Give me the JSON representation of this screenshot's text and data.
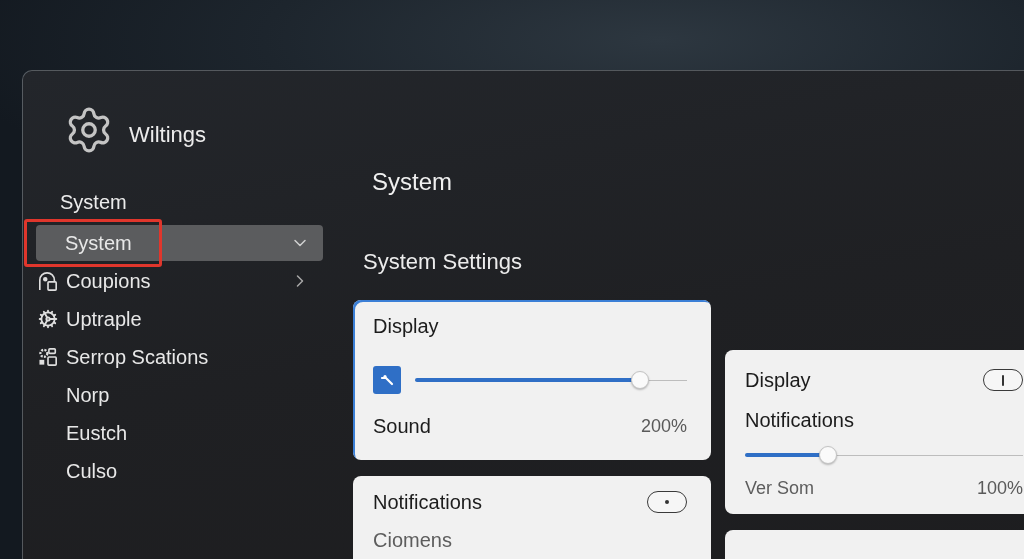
{
  "app": {
    "title": "Wiltings"
  },
  "sidebar": {
    "items": [
      {
        "kind": "header",
        "label": "System"
      },
      {
        "kind": "entry",
        "label": "System",
        "selected": true,
        "expanded": true,
        "outlined": true
      },
      {
        "kind": "item",
        "label": "Coupions",
        "selected": false,
        "expanded": false
      },
      {
        "kind": "item",
        "label": "Uptraple",
        "selected": false
      },
      {
        "kind": "item",
        "label": "Serrop Scations",
        "selected": false
      },
      {
        "kind": "item",
        "label": "Norp",
        "selected": false
      },
      {
        "kind": "item",
        "label": "Eustch",
        "selected": false
      },
      {
        "kind": "item",
        "label": "Culso",
        "selected": false
      }
    ]
  },
  "content": {
    "title": "System",
    "section": "System Settings",
    "cards": [
      {
        "selected": true,
        "rows": [
          {
            "kind": "title",
            "label": "Display"
          },
          {
            "kind": "icon-slider",
            "level": 0.85
          },
          {
            "kind": "value",
            "label": "Sound",
            "value": "200%"
          }
        ]
      },
      {
        "selected": false,
        "rows": [
          {
            "kind": "toggle",
            "label": "Display",
            "on": true
          },
          {
            "kind": "title",
            "label": "Notifications"
          },
          {
            "kind": "slider",
            "level": 0.285
          },
          {
            "kind": "caption-value",
            "label": "Ver Som",
            "value": "100%"
          }
        ]
      },
      {
        "selected": false,
        "rows": [
          {
            "kind": "toggle",
            "label": "Notifications",
            "on": false
          },
          {
            "kind": "text",
            "label": "Ciomens"
          }
        ]
      },
      {
        "selected": false
      }
    ]
  }
}
